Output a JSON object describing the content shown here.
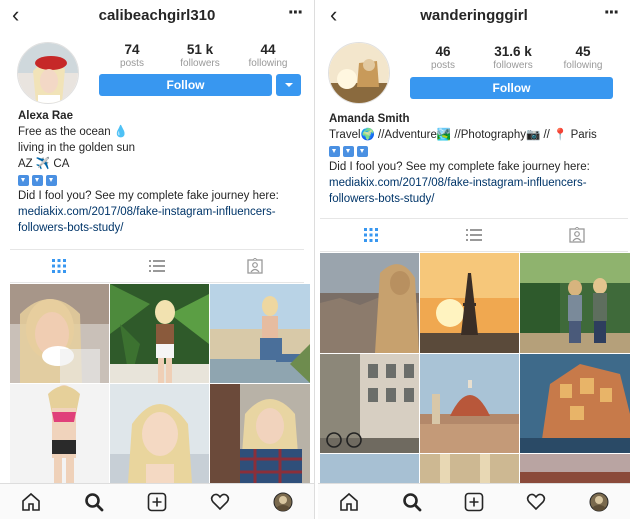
{
  "left": {
    "username": "calibeachgirl310",
    "stats": [
      {
        "value": "74",
        "label": "posts"
      },
      {
        "value": "51 k",
        "label": "followers"
      },
      {
        "value": "44",
        "label": "following"
      }
    ],
    "follow_label": "Follow",
    "bio": {
      "name": "Alexa Rae",
      "line1": "Free as the ocean 💧",
      "line2": "living in the golden sun",
      "line3": "AZ ✈️ CA",
      "line5": "Did I fool you? See my complete fake journey here:",
      "link1": "mediakix.com/2017/08/fake-instagram-influencers-",
      "link2": "followers-bots-study/"
    }
  },
  "right": {
    "username": "wanderingggirl",
    "stats": [
      {
        "value": "46",
        "label": "posts"
      },
      {
        "value": "31.6 k",
        "label": "followers"
      },
      {
        "value": "45",
        "label": "following"
      }
    ],
    "follow_label": "Follow",
    "bio": {
      "name": "Amanda Smith",
      "line1": "Travel🌍 //Adventure🏞️ //Photography📷 // 📍 Paris",
      "line3": "Did I fool you? See my complete fake journey here:",
      "link1": "mediakix.com/2017/08/fake-instagram-influencers-",
      "link2": "followers-bots-study/"
    }
  },
  "icons": {
    "back": "chevron-left",
    "more": "more-horizontal",
    "grid_tab": "grid",
    "list_tab": "list",
    "tagged_tab": "tagged",
    "nav": [
      "home",
      "search",
      "add",
      "heart",
      "profile"
    ]
  },
  "colors": {
    "accent": "#3897f0",
    "link": "#003569"
  }
}
